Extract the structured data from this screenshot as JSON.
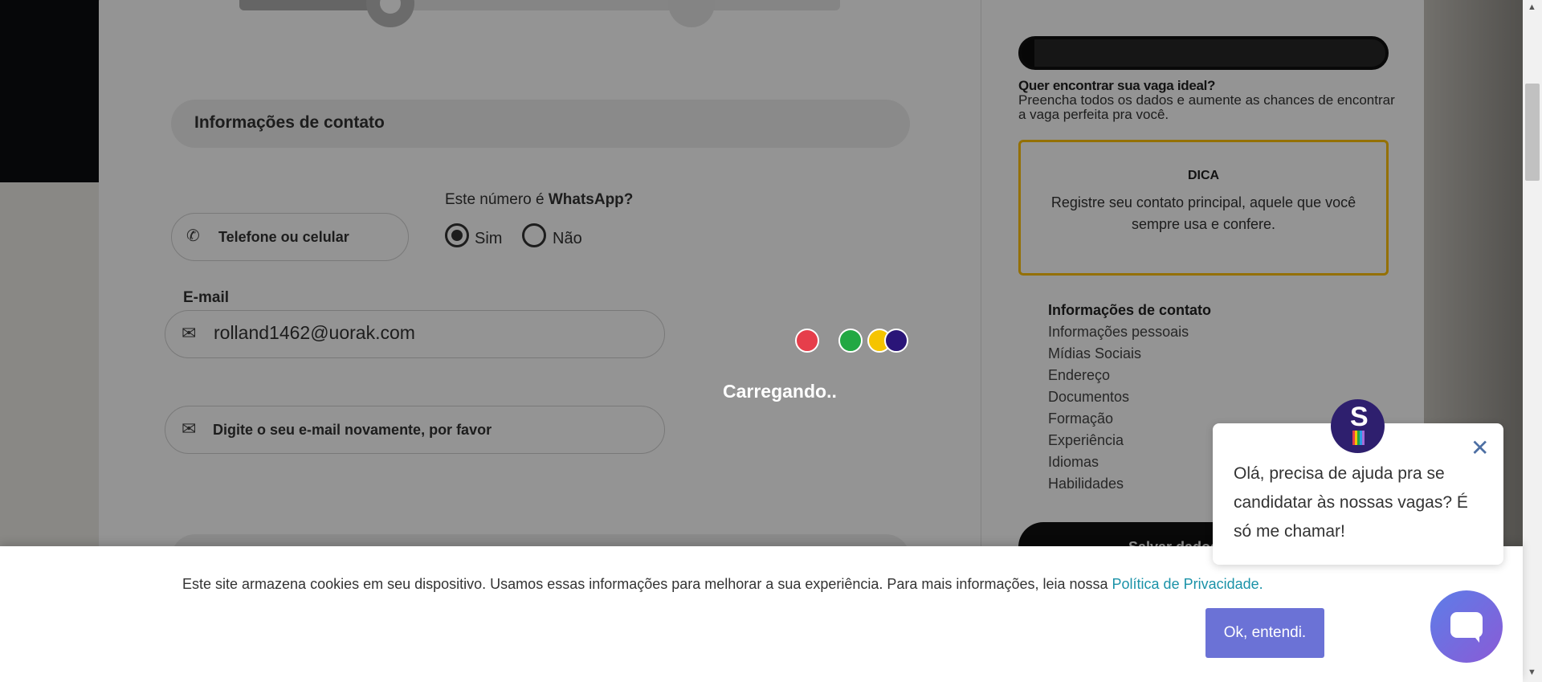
{
  "form": {
    "section_title": "Informações de contato",
    "phone_label": "Telefone ou celular",
    "whatsapp_question_prefix": "Este número é ",
    "whatsapp_question_bold": "WhatsApp?",
    "radio_yes": "Sim",
    "radio_no": "Não",
    "whatsapp_selected": "Sim",
    "email_label": "E-mail",
    "email_value": "rolland1462@uorak.com",
    "email_confirm_placeholder": "Digite o seu e-mail novamente, por favor",
    "step_progress": 0.25
  },
  "sidebar": {
    "profile_progress": 0.04,
    "tip_title": "Quer encontrar sua vaga ideal?",
    "tip_text": "Preencha todos os dados e aumente as chances de encontrar a vaga perfeita pra você.",
    "dica_title": "DICA",
    "dica_text": "Registre seu contato principal, aquele que você sempre usa e confere.",
    "steps": [
      "Informações de contato",
      "Informações pessoais",
      "Mídias Sociais",
      "Endereço",
      "Documentos",
      "Formação",
      "Experiência",
      "Idiomas",
      "Habilidades"
    ],
    "active_step": 0,
    "save_label": "Salvar dados e ir para"
  },
  "loading": {
    "text": "Carregando..",
    "dot_colors": [
      "#e63e4b",
      "#22a843",
      "#f5c400",
      "#2a1578"
    ]
  },
  "cookie": {
    "text": "Este site armazena cookies em seu dispositivo. Usamos essas informações para melhorar a sua experiência. Para mais informações, leia nossa ",
    "link": "Política de Privacidade.",
    "ok_label": "Ok, entendi."
  },
  "chat": {
    "message": "Olá, precisa de ajuda pra se candidatar às nossas vagas? É só me chamar!",
    "avatar_letter": "S"
  },
  "colors": {
    "accent_yellow": "#ffc107",
    "cookie_button": "#6b72d6",
    "link": "#1a92a8",
    "chat_launcher": "#6b6fe0"
  }
}
